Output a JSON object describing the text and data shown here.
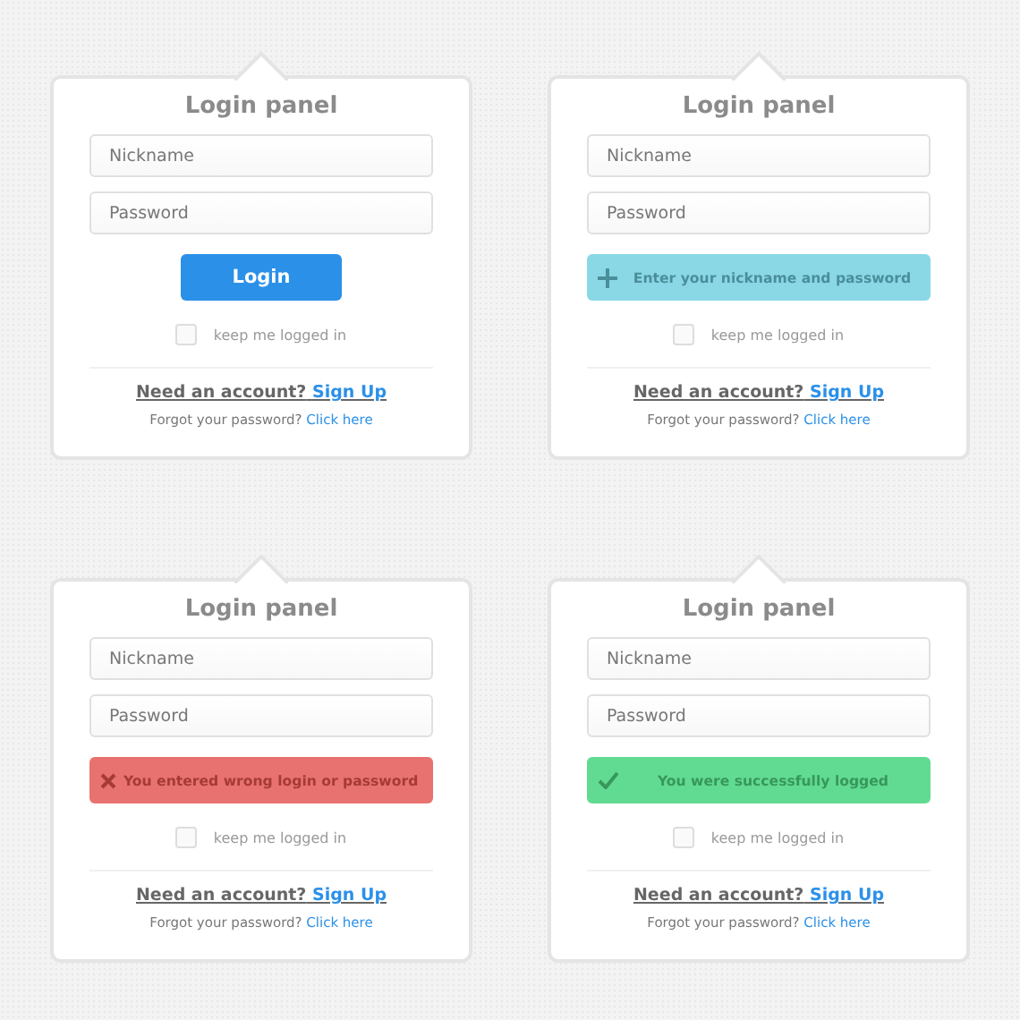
{
  "panels": [
    {
      "title": "Login panel",
      "fields": [
        {
          "placeholder": "Nickname"
        },
        {
          "placeholder": "Password"
        }
      ],
      "action": {
        "kind": "button",
        "label": "Login"
      },
      "remember": {
        "label": "keep me logged in",
        "checked": false
      },
      "signup": {
        "prompt": "Need an account?",
        "link": "Sign Up"
      },
      "forgot": {
        "prompt": "Forgot your password?",
        "link": "Click here"
      }
    },
    {
      "title": "Login panel",
      "fields": [
        {
          "placeholder": "Nickname"
        },
        {
          "placeholder": "Password"
        }
      ],
      "action": {
        "kind": "info",
        "label": "Enter your nickname and password"
      },
      "remember": {
        "label": "keep me logged in",
        "checked": false
      },
      "signup": {
        "prompt": "Need an account?",
        "link": "Sign Up"
      },
      "forgot": {
        "prompt": "Forgot your password?",
        "link": "Click here"
      }
    },
    {
      "title": "Login panel",
      "fields": [
        {
          "placeholder": "Nickname"
        },
        {
          "placeholder": "Password"
        }
      ],
      "action": {
        "kind": "error",
        "label": "You entered wrong login or password"
      },
      "remember": {
        "label": "keep me logged in",
        "checked": false
      },
      "signup": {
        "prompt": "Need an account?",
        "link": "Sign Up"
      },
      "forgot": {
        "prompt": "Forgot your password?",
        "link": "Click here"
      }
    },
    {
      "title": "Login panel",
      "fields": [
        {
          "placeholder": "Nickname"
        },
        {
          "placeholder": "Password"
        }
      ],
      "action": {
        "kind": "success",
        "label": "You were successfully logged"
      },
      "remember": {
        "label": "keep me logged in",
        "checked": false
      },
      "signup": {
        "prompt": "Need an account?",
        "link": "Sign Up"
      },
      "forgot": {
        "prompt": "Forgot your password?",
        "link": "Click here"
      }
    }
  ]
}
